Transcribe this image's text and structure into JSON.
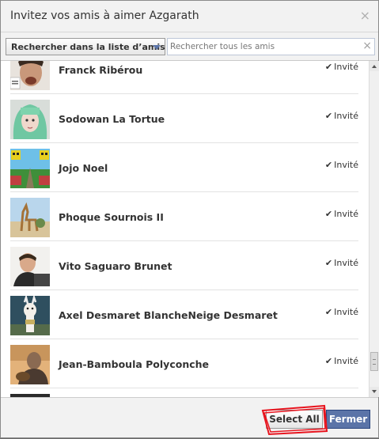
{
  "dialog": {
    "title": "Invitez vos amis à aimer Azgarath",
    "close_icon": "×"
  },
  "search": {
    "filter_label": "Rechercher dans la liste d’amis",
    "placeholder": "Rechercher tous les amis",
    "clear_icon": "×"
  },
  "friends": [
    {
      "name": "Franck Ribérou",
      "status": "Invité",
      "check": "✔"
    },
    {
      "name": "Sodowan La Tortue",
      "status": "Invité",
      "check": "✔"
    },
    {
      "name": "Jojo Noel",
      "status": "Invité",
      "check": "✔"
    },
    {
      "name": "Phoque Sournois II",
      "status": "Invité",
      "check": "✔"
    },
    {
      "name": "Vito Saguaro Brunet",
      "status": "Invité",
      "check": "✔"
    },
    {
      "name": "Axel Desmaret BlancheNeige Desmaret",
      "status": "Invité",
      "check": "✔"
    },
    {
      "name": "Jean-Bamboula Polyconche",
      "status": "Invité",
      "check": "✔"
    }
  ],
  "footer": {
    "select_all_label": "Select All",
    "close_label": "Fermer"
  },
  "colors": {
    "accent": "#5b74a8",
    "annotation": "#e8141e"
  }
}
